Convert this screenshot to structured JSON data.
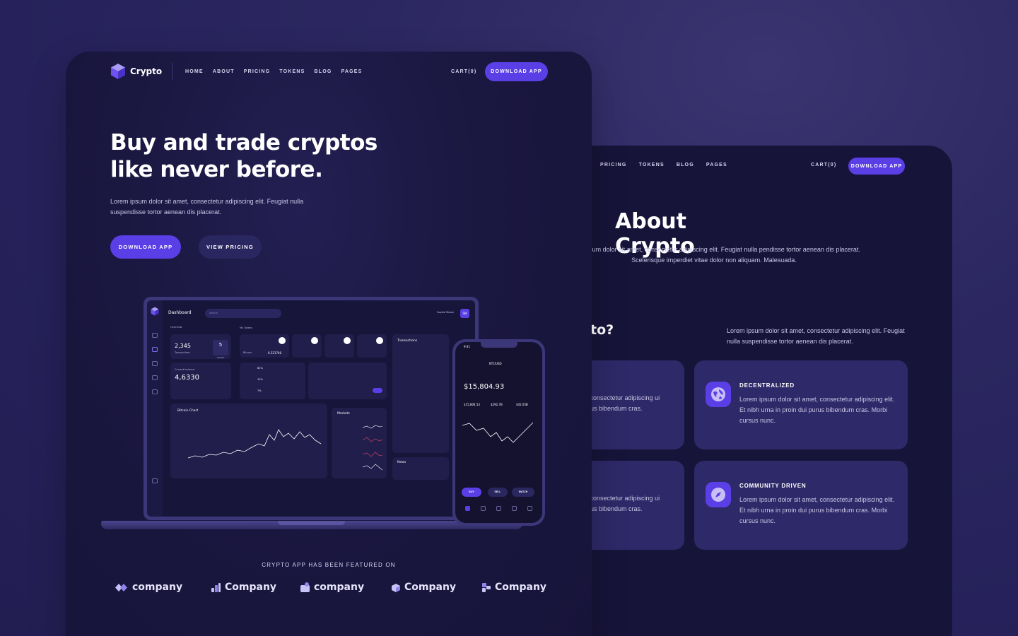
{
  "back": {
    "nav": [
      "PRICING",
      "TOKENS",
      "BLOG",
      "PAGES"
    ],
    "cart": "CART(0)",
    "download": "DOWNLOAD APP",
    "title": "About Crypto",
    "text": "orem ipsum dolor sit amet, consectetur adipiscing elit. Feugiat nulla pendisse tortor aenean dis placerat. Scelerisque imperdiet vitae dolor non aliquam. Malesuada.",
    "why_title": "to?",
    "why_text": "Lorem ipsum dolor sit amet, consectetur adipiscing elit. Feugiat nulla suspendisse tortor aenean dis placerat.",
    "left_card_text": "et, consectetur adipiscing ui purus bibendum cras.",
    "cards": [
      {
        "title": "DECENTRALIZED",
        "text": "Lorem ipsum dolor sit amet, consectetur adipiscing elit. Et nibh urna in proin dui purus bibendum cras. Morbi cursus nunc.",
        "icon": "globe-icon"
      },
      {
        "title": "COMMUNITY DRIVEN",
        "text": "Lorem ipsum dolor sit amet, consectetur adipiscing elit. Et nibh urna in proin dui purus bibendum cras. Morbi cursus nunc.",
        "icon": "compass-icon"
      }
    ]
  },
  "front": {
    "logo": "Crypto",
    "nav": [
      "HOME",
      "ABOUT",
      "PRICING",
      "TOKENS",
      "BLOG",
      "PAGES"
    ],
    "cart": "CART(0)",
    "download": "DOWNLOAD APP",
    "hero_title": "Buy and trade cryptos like never before.",
    "hero_text": "Lorem ipsum dolor sit amet, consectetur adipiscing elit. Feugiat nulla suspendisse tortor aenean dis placerat.",
    "btn_download": "DOWNLOAD APP",
    "btn_pricing": "VIEW PRICING",
    "featured": "CRYPTO APP HAS BEEN FEATURED ON",
    "brands": [
      "company",
      "Company",
      "company",
      "Company",
      "Company"
    ]
  },
  "dashboard": {
    "title": "Dashboard",
    "search": "Search",
    "user": "Sophie Moore",
    "avatar": "SM",
    "overview": "Overview",
    "my_tokens": "My Tokens",
    "transactions_count": "2,345",
    "transactions_label": "Transactions",
    "wallets": "5",
    "wallets_label": "wallets",
    "balance_label": "Current balance",
    "balance": "4,6330",
    "token_value": "0.321746",
    "token_name": "Bitcoin",
    "pct": [
      "81%",
      "12%",
      "7%"
    ],
    "chart_title": "Bitcoin Chart",
    "markets": "Markets",
    "transactions": "Transactions",
    "news": "News"
  },
  "phone": {
    "time": "9:41",
    "pair": "BTC/USD",
    "price": "$15,804.93",
    "stats": [
      "$15,804.53",
      "$292.7B",
      "$42.05B"
    ],
    "buttons": [
      "BUY",
      "SELL",
      "WATCH"
    ]
  },
  "colors": {
    "accent": "#5b3fe6",
    "panel": "#17143a",
    "card": "#2e2968"
  }
}
